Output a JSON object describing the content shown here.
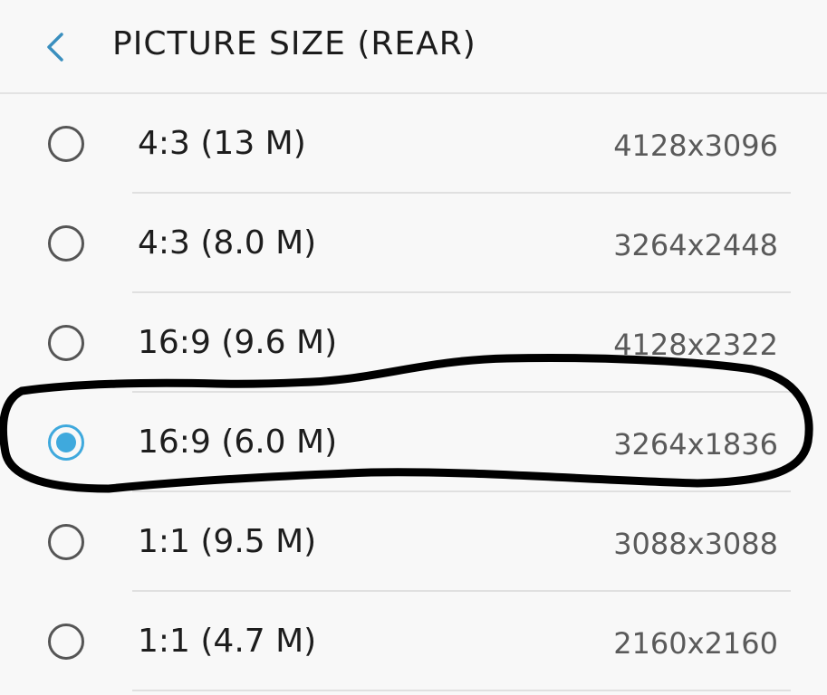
{
  "header": {
    "title": "PICTURE SIZE (REAR)",
    "back_icon": "chevron-left-icon"
  },
  "colors": {
    "accent": "#3fa9dd",
    "background": "#f8f8f8",
    "divider": "#e0e0e0",
    "annotation": "#000000"
  },
  "options": [
    {
      "label": "4:3 (13 M)",
      "resolution": "4128x3096",
      "selected": false
    },
    {
      "label": "4:3 (8.0 M)",
      "resolution": "3264x2448",
      "selected": false
    },
    {
      "label": "16:9 (9.6 M)",
      "resolution": "4128x2322",
      "selected": false
    },
    {
      "label": "16:9 (6.0 M)",
      "resolution": "3264x1836",
      "selected": true
    },
    {
      "label": "1:1 (9.5 M)",
      "resolution": "3088x3088",
      "selected": false
    },
    {
      "label": "1:1 (4.7 M)",
      "resolution": "2160x2160",
      "selected": false
    }
  ]
}
